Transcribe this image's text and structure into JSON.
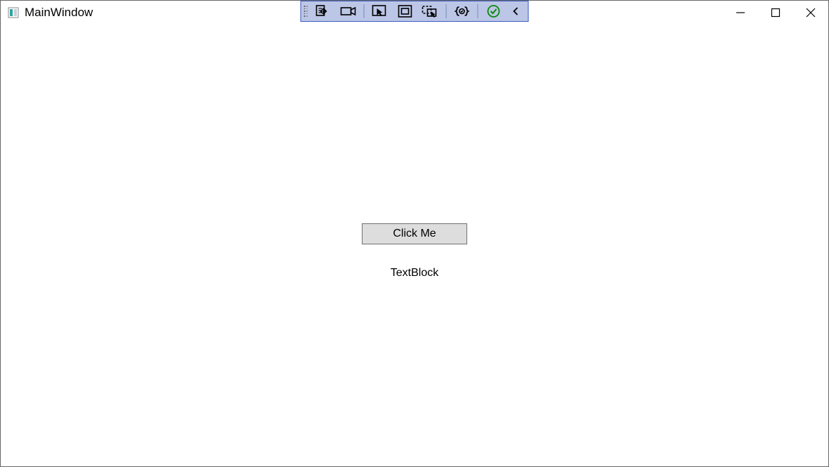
{
  "window": {
    "title": "MainWindow"
  },
  "content": {
    "button_label": "Click Me",
    "textblock": "TextBlock"
  },
  "debug_toolbar": {
    "items": [
      "visual-tree",
      "record",
      "select-element",
      "layout-adorners",
      "track-focus",
      "xaml-binding",
      "hot-reload-ok",
      "collapse"
    ]
  }
}
